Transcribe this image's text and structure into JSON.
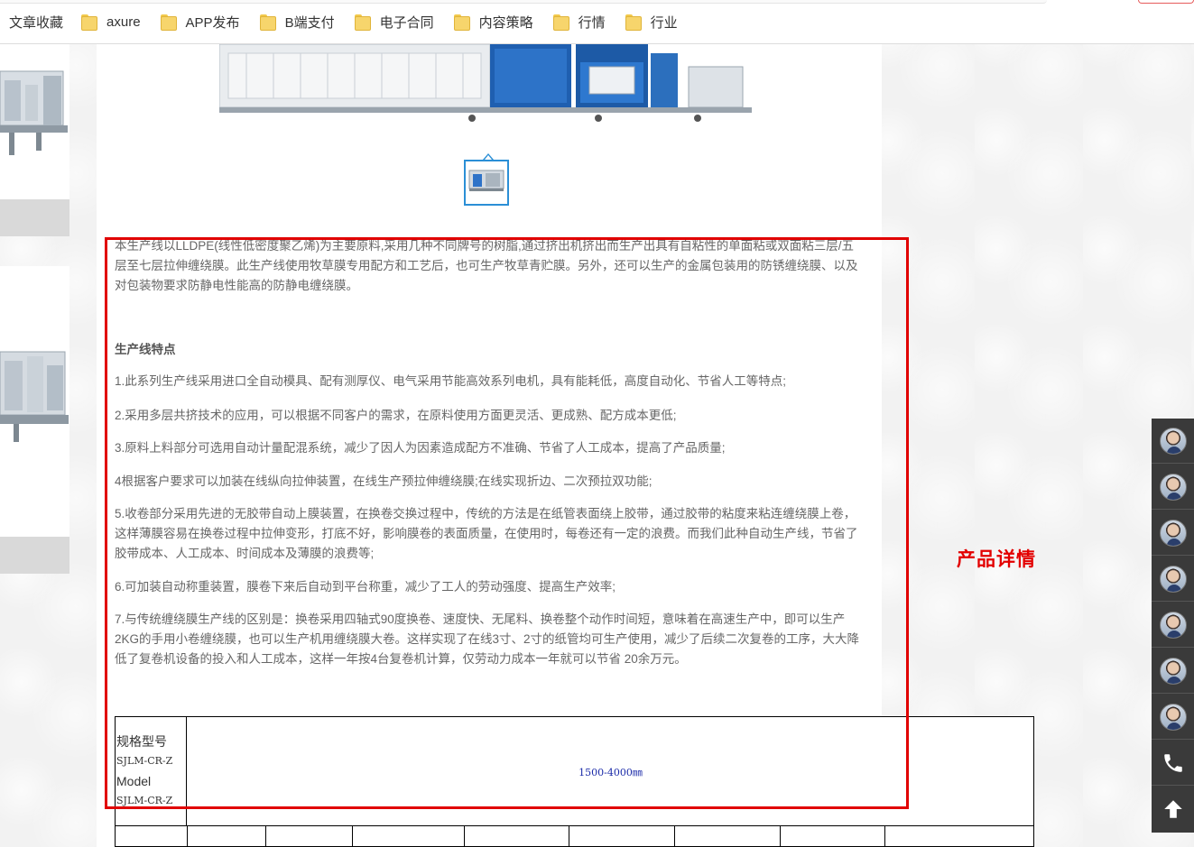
{
  "bookmarks": {
    "items": [
      {
        "label": "文章收藏",
        "folder": false
      },
      {
        "label": "axure",
        "folder": true
      },
      {
        "label": "APP发布",
        "folder": true
      },
      {
        "label": "B端支付",
        "folder": true
      },
      {
        "label": "电子合同",
        "folder": true
      },
      {
        "label": "内容策略",
        "folder": true
      },
      {
        "label": "行情",
        "folder": true
      },
      {
        "label": "行业",
        "folder": true
      }
    ]
  },
  "product": {
    "intro": "本生产线以LLDPE(线性低密度聚乙烯)为主要原料,采用几种不同牌号的树脂,通过挤出机挤出而生产出具有自粘性的单面粘或双面粘三层/五层至七层拉伸缠绕膜。此生产线使用牧草膜专用配方和工艺后，也可生产牧草青贮膜。另外，还可以生产的金属包装用的防锈缠绕膜、以及对包装物要求防静电性能高的防静电缠绕膜。",
    "heading": "生产线特点",
    "features": [
      "1.此系列生产线采用进口全自动模具、配有测厚仪、电气采用节能高效系列电机，具有能耗低，高度自动化、节省人工等特点;",
      "2.采用多层共挤技术的应用，可以根据不同客户的需求，在原料使用方面更灵活、更成熟、配方成本更低;",
      "3.原料上料部分可选用自动计量配混系统，减少了因人为因素造成配方不准确、节省了人工成本，提高了产品质量;",
      "4根据客户要求可以加装在线纵向拉伸装置，在线生产预拉伸缠绕膜;在线实现折边、二次预拉双功能;",
      "5.收卷部分采用先进的无胶带自动上膜装置，在换卷交换过程中，传统的方法是在纸管表面绕上胶带，通过胶带的粘度来粘连缠绕膜上卷，这样薄膜容易在换卷过程中拉伸变形，打底不好，影响膜卷的表面质量，在使用时，每卷还有一定的浪费。而我们此种自动生产线，节省了胶带成本、人工成本、时间成本及薄膜的浪费等;",
      "6.可加装自动称重装置，膜卷下来后自动到平台称重，减少了工人的劳动强度、提高生产效率;",
      "7.与传统缠绕膜生产线的区别是：换卷采用四轴式90度换卷、速度快、无尾料、换卷整个动作时间短，意味着在高速生产中，即可以生产2KG的手用小卷缠绕膜，也可以生产机用缠绕膜大卷。这样实现了在线3寸、2寸的纸管均可生产使用，减少了后续二次复卷的工序，大大降低了复卷机设备的投入和人工成本，这样一年按4台复卷机计算，仅劳动力成本一年就可以节省 20余万元。"
    ]
  },
  "spec_table": {
    "label_cn": "规格型号",
    "model_code_1": "SJLM-CR-Z",
    "label_en": "Model",
    "model_code_2": "SJLM-CR-Z",
    "value": "1500-4000㎜"
  },
  "annotation": {
    "text": "产品详情",
    "color": "#e30000"
  },
  "float_bar": {
    "items": [
      "avatar-icon",
      "avatar-icon",
      "avatar-icon",
      "avatar-icon",
      "avatar-icon",
      "avatar-icon",
      "avatar-icon",
      "phone-icon",
      "arrow-up-icon"
    ]
  }
}
